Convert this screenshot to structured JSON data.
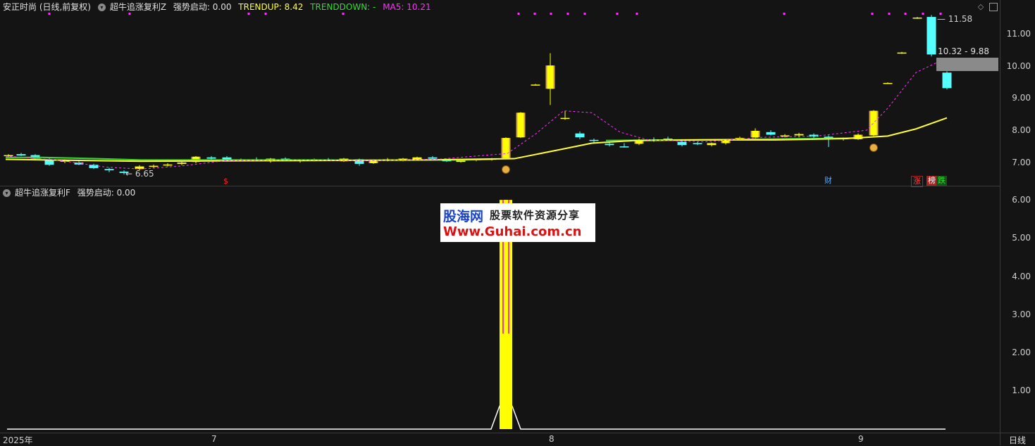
{
  "main_header": {
    "stock": "安正时尚 (日线,前复权)",
    "indicator": "超牛追涨复利Z",
    "start_label": "强势启动: 0.00",
    "trendup": "TRENDUP: 8.42",
    "trenddown": "TRENDDOWN: -",
    "ma5": "MA5: 10.21"
  },
  "sub_header": {
    "indicator": "超牛追涨复利F",
    "start_label": "强势启动: 0.00"
  },
  "price_axis_ticks": [
    "11.00",
    "10.00",
    "9.00",
    "8.00",
    "7.00"
  ],
  "sub_axis_ticks": [
    "6.00",
    "5.00",
    "4.00",
    "3.00",
    "2.00",
    "1.00"
  ],
  "x_axis_labels": [
    "2025年",
    "7",
    "8",
    "9"
  ],
  "period_label": "日线",
  "annotations": {
    "low_price": "6.65",
    "high_price": "11.58",
    "range_box": "10.32 - 9.88"
  },
  "markers": {
    "cai": "财",
    "zhang": "涨",
    "bang": "榜",
    "die": "跌",
    "dollar": "$"
  },
  "watermark": {
    "line1a": "股海网",
    "line1b": "股票软件资源分享",
    "line2": "Www.Guhai.com.cn"
  },
  "colors": {
    "up": "#ffff00",
    "down": "#55ffff",
    "ma5": "#ff33ff",
    "trendup": "#ffff33",
    "trenddown": "#33dd33",
    "bar_magenta": "#ff3399"
  },
  "chart_data": {
    "type": "candlestick",
    "ylim": [
      6.4,
      11.8
    ],
    "subchart_ylim": [
      0,
      6.2
    ],
    "subchart_signal": {
      "label": "强势启动",
      "peak": 6.0
    }
  }
}
